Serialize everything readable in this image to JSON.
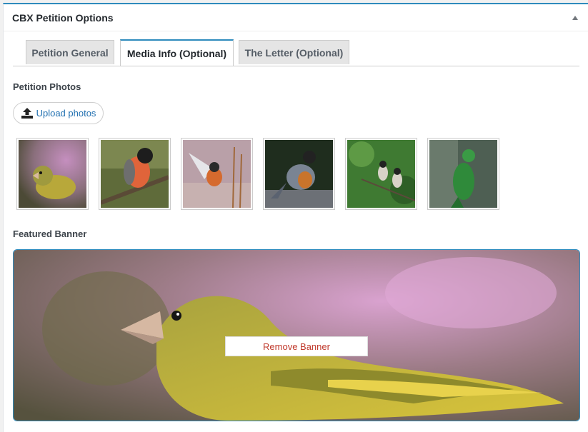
{
  "panel": {
    "title": "CBX Petition Options"
  },
  "tabs": [
    {
      "label": "Petition General",
      "active": false
    },
    {
      "label": "Media Info (Optional)",
      "active": true
    },
    {
      "label": "The Letter (Optional)",
      "active": false
    }
  ],
  "photos": {
    "label": "Petition Photos",
    "upload_label": "Upload photos",
    "items": [
      "greenfinch-photo",
      "bullfinch-photo",
      "flying-bird-photo",
      "robin-photo",
      "bulbul-pair-photo",
      "green-bird-photo"
    ]
  },
  "banner": {
    "label": "Featured Banner",
    "remove_label": "Remove Banner"
  },
  "colors": {
    "accent": "#2e8bbd",
    "remove": "#c0392b"
  }
}
